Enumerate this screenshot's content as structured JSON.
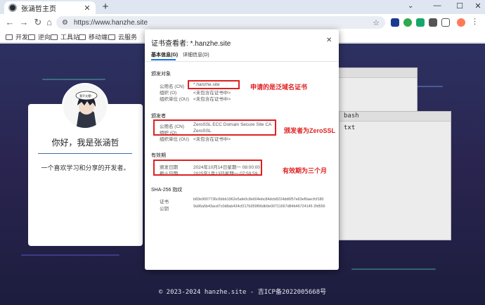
{
  "tab": {
    "title": "张涵哲主页"
  },
  "omnibox": {
    "url": "https://www.hanzhe.site"
  },
  "bookmarks": [
    "开发",
    "逆向",
    "工具站",
    "移动端",
    "云服务"
  ],
  "profile": {
    "greeting": "你好，我是张涵哲",
    "intro": "一个喜欢学习和分享的开发者。",
    "avatar_caption": "我不太懂！"
  },
  "terminal": {
    "title": "bash",
    "line": "txt"
  },
  "footer": {
    "text": "© 2023-2024 hanzhe.site - 吉ICP备2022005668号"
  },
  "dialog": {
    "title": "证书查看者: *.hanzhe.site",
    "tabs": [
      "基本信息(G)",
      "详细信息(D)"
    ],
    "issued_to": {
      "heading": "颁发对象",
      "rows": [
        {
          "label": "公用名 (CN)",
          "value": "*.hanzhe.site"
        },
        {
          "label": "组织 (O)",
          "value": "<未包含在证书中>"
        },
        {
          "label": "组织单位 (OU)",
          "value": "<未包含在证书中>"
        }
      ]
    },
    "issuer": {
      "heading": "颁发者",
      "rows": [
        {
          "label": "公用名 (CN)",
          "value": "ZeroSSL ECC Domain Secure Site CA"
        },
        {
          "label": "组织 (O)",
          "value": "ZeroSSL"
        },
        {
          "label": "组织单位 (OU)",
          "value": "<未包含在证书中>"
        }
      ]
    },
    "validity": {
      "heading": "有效期",
      "rows": [
        {
          "label": "颁发日期",
          "value": "2024年10月14日星期一 08:00:00"
        },
        {
          "label": "截止日期",
          "value": "2025年1月13日星期一 07:59:59"
        }
      ]
    },
    "fingerprints": {
      "heading": "SHA-256 指纹",
      "rows": [
        {
          "label": "证书",
          "value": "b83e9007736c6bbb1962e5afe0c8e604ebc84dcb8224dd6f57e63ef0aecfcf180"
        },
        {
          "label": "公钥",
          "value": "9a96a5b43acd7c0d8ab434cf217b359f06db9e00711667d84b46724145 2fd556"
        }
      ]
    }
  },
  "annotations": {
    "wildcard": "申请的是泛域名证书",
    "issuer": "颁发者为ZeroSSL",
    "validity": "有效期为三个月"
  },
  "colors": {
    "annotation_red": "#e02020",
    "page_bg": "#2a2550",
    "accent_blue": "#1a73e8"
  }
}
